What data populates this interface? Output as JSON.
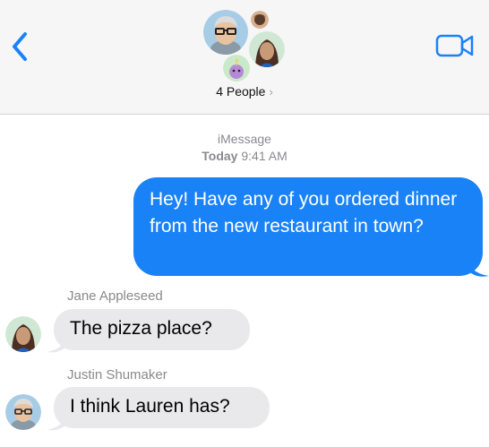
{
  "header": {
    "title": "4 People",
    "chevron": "›"
  },
  "meta": {
    "service": "iMessage",
    "day": "Today",
    "time": "9:41 AM"
  },
  "messages": {
    "outgoing_1": "Hey! Have any of you ordered dinner from the new restaurant in town?",
    "sender_1": "Jane Appleseed",
    "incoming_1": "The pizza place?",
    "sender_2": "Justin Shumaker",
    "incoming_2": "I think Lauren has?"
  },
  "colors": {
    "accent": "#1a82f7",
    "incoming_bubble": "#e9e9eb",
    "header_bg": "#f6f6f7",
    "secondary_text": "#8a8a8e"
  },
  "icons": [
    "back-chevron-icon",
    "video-call-icon"
  ]
}
